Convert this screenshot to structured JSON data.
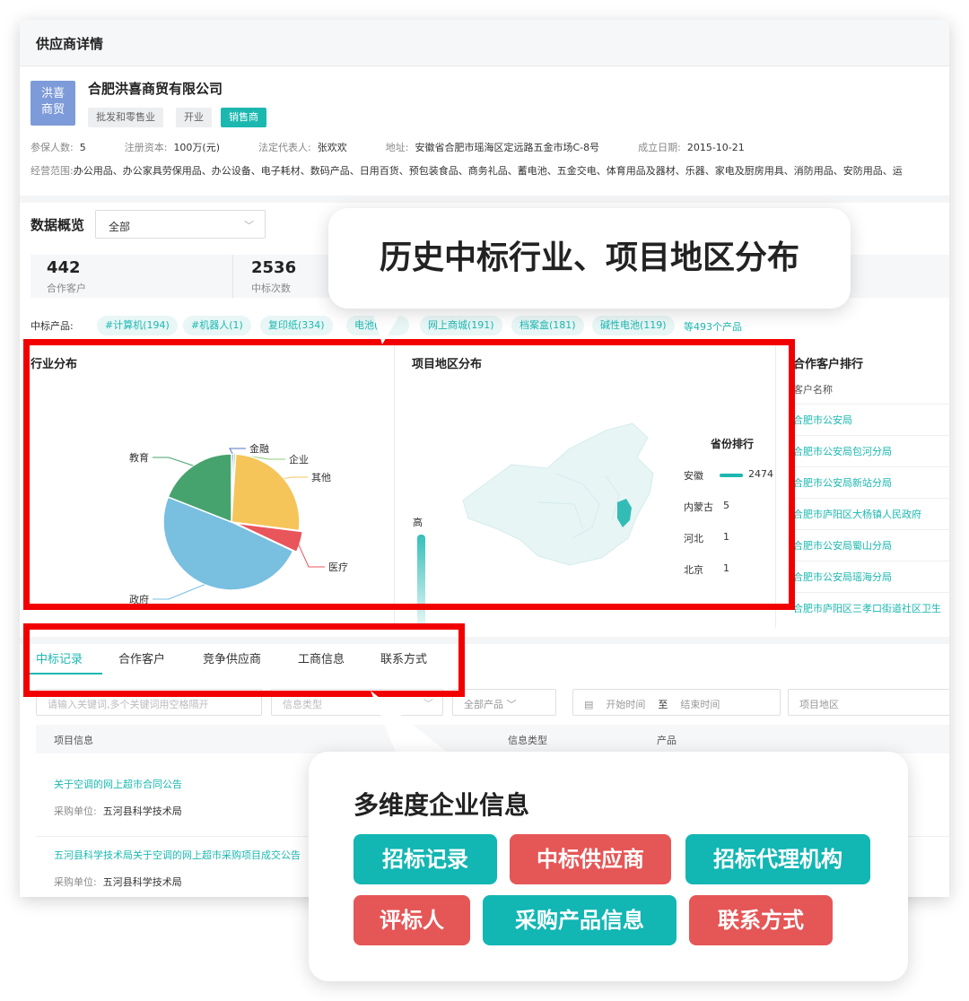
{
  "header": {
    "title": "供应商详情"
  },
  "company": {
    "logo_text": [
      "洪喜",
      "商贸"
    ],
    "name": "合肥洪喜商贸有限公司",
    "tags": [
      "批发和零售业",
      "开业",
      "销售商"
    ],
    "info": [
      {
        "k": "参保人数:",
        "v": "5"
      },
      {
        "k": "注册资本:",
        "v": "100万(元)"
      },
      {
        "k": "法定代表人:",
        "v": "张欢欢"
      },
      {
        "k": "地址:",
        "v": "安徽省合肥市瑶海区定远路五金市场C-8号"
      },
      {
        "k": "成立日期:",
        "v": "2015-10-21"
      }
    ],
    "scope_label": "经营范围:",
    "scope": "办公用品、办公家具劳保用品、办公设备、电子耗材、数码产品、日用百货、预包装食品、商务礼品、蓄电池、五金交电、体育用品及器材、乐器、家电及厨房用具、消防用品、安防用品、运"
  },
  "overview": {
    "title": "数据概览",
    "select_value": "全部",
    "stats": [
      {
        "value": "442",
        "label": "合作客户"
      },
      {
        "value": "2536",
        "label": "中标次数"
      }
    ],
    "products_label": "中标产品:",
    "products": [
      "#计算机(194)",
      "#机器人(1)",
      "复印纸(334)",
      "电池(2",
      "网上商城(191)",
      "档案盒(181)",
      "碱性电池(119)"
    ],
    "products_more": "等493个产品"
  },
  "industry": {
    "title": "行业分布",
    "labels": [
      "金融",
      "企业",
      "其他",
      "医疗",
      "政府",
      "教育"
    ]
  },
  "chart_data": {
    "type": "pie",
    "title": "行业分布",
    "categories": [
      "金融",
      "企业",
      "其他",
      "医疗",
      "政府",
      "教育"
    ],
    "values": [
      0.5,
      0.5,
      26,
      5,
      49,
      19
    ]
  },
  "region": {
    "title": "项目地区分布",
    "legend_high": "高",
    "rank_title": "省份排行",
    "ranks": [
      {
        "name": "安徽",
        "value": "2474"
      },
      {
        "name": "内蒙古",
        "value": "5"
      },
      {
        "name": "河北",
        "value": "1"
      },
      {
        "name": "北京",
        "value": "1"
      }
    ]
  },
  "customers": {
    "title": "合作客户排行",
    "header": "客户名称",
    "items": [
      "合肥市公安局",
      "合肥市公安局包河分局",
      "合肥市公安局新站分局",
      "合肥市庐阳区大杨镇人民政府",
      "合肥市公安局蜀山分局",
      "合肥市公安局瑶海分局",
      "合肥市庐阳区三孝口街道社区卫生"
    ]
  },
  "tabs": [
    "中标记录",
    "合作客户",
    "竞争供应商",
    "工商信息",
    "联系方式"
  ],
  "filters": {
    "keyword_placeholder": "请输入关键词,多个关键词用空格隔开",
    "info_type": "信息类型",
    "product": "全部产品",
    "start": "开始时间",
    "to": "至",
    "end": "结束时间",
    "region": "项目地区"
  },
  "table": {
    "headers": [
      "项目信息",
      "信息类型",
      "产品"
    ],
    "rows": [
      {
        "title": "关于空调的网上超市合同公告",
        "unit_label": "采购单位:",
        "unit": "五河县科学技术局"
      },
      {
        "title": "五河县科学技术局关于空调的网上超市采购项目成交公告",
        "unit_label": "采购单位:",
        "unit": "五河县科学技术局"
      }
    ]
  },
  "callout1": "历史中标行业、项目地区分布",
  "callout2": {
    "title": "多维度企业信息",
    "buttons": [
      "招标记录",
      "中标供应商",
      "招标代理机构",
      "评标人",
      "采购产品信息",
      "联系方式"
    ]
  }
}
